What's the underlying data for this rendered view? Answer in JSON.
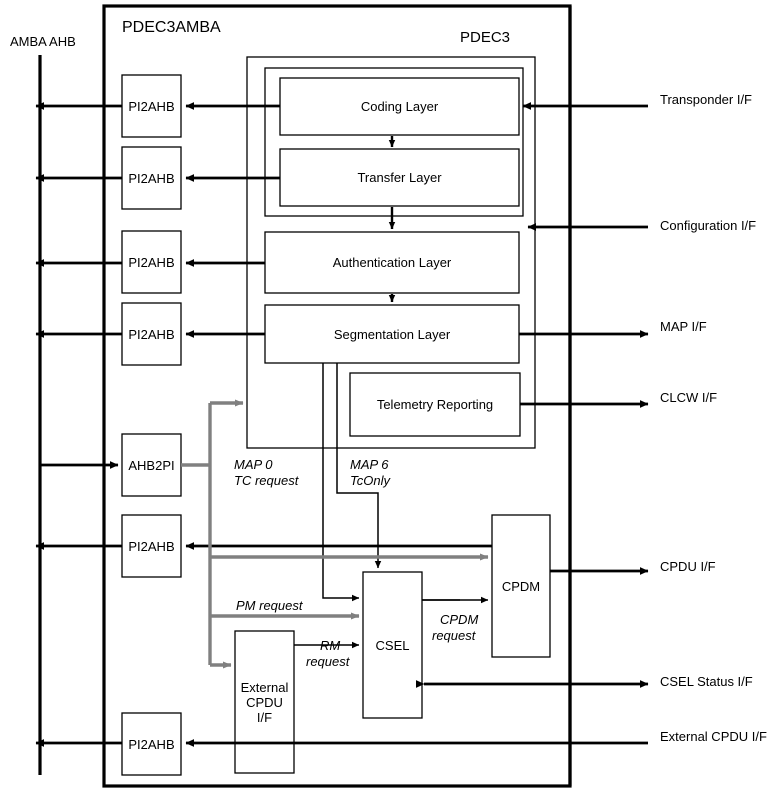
{
  "diagram": {
    "title_outer": "PDEC3AMBA",
    "title_inner": "PDEC3",
    "bus_label": "AMBA AHB",
    "colors": {
      "line": "#000000",
      "gray_line": "#808080",
      "background": "#ffffff",
      "box_stroke": "#000000"
    }
  },
  "bridges": {
    "pi2ahb_label": "PI2AHB",
    "ahb2pi_label": "AHB2PI",
    "instances": [
      {
        "id": "pi2ahb-1",
        "label": "PI2AHB"
      },
      {
        "id": "pi2ahb-2",
        "label": "PI2AHB"
      },
      {
        "id": "pi2ahb-3",
        "label": "PI2AHB"
      },
      {
        "id": "pi2ahb-4",
        "label": "PI2AHB"
      },
      {
        "id": "ahb2pi-1",
        "label": "AHB2PI"
      },
      {
        "id": "pi2ahb-5",
        "label": "PI2AHB"
      },
      {
        "id": "pi2ahb-6",
        "label": "PI2AHB"
      }
    ]
  },
  "layers": [
    {
      "id": "coding-layer",
      "label": "Coding Layer"
    },
    {
      "id": "transfer-layer",
      "label": "Transfer Layer"
    },
    {
      "id": "authentication-layer",
      "label": "Authentication Layer"
    },
    {
      "id": "segmentation-layer",
      "label": "Segmentation Layer"
    },
    {
      "id": "telemetry-reporting",
      "label": "Telemetry Reporting"
    }
  ],
  "blocks": [
    {
      "id": "cpdm",
      "label": "CPDM"
    },
    {
      "id": "csel",
      "label": "CSEL"
    },
    {
      "id": "external-cpdu-if",
      "label": "External\nCPDU\nI/F"
    }
  ],
  "interfaces": [
    {
      "id": "transponder-if",
      "label": "Transponder I/F",
      "direction": "in"
    },
    {
      "id": "configuration-if",
      "label": "Configuration I/F",
      "direction": "in"
    },
    {
      "id": "map-if",
      "label": "MAP I/F",
      "direction": "out"
    },
    {
      "id": "clcw-if",
      "label": "CLCW I/F",
      "direction": "out"
    },
    {
      "id": "cpdu-if",
      "label": "CPDU I/F",
      "direction": "out"
    },
    {
      "id": "csel-status-if",
      "label": "CSEL Status I/F",
      "direction": "bidirectional"
    },
    {
      "id": "external-cpdu-if-signal",
      "label": "External CPDU I/F",
      "direction": "in"
    }
  ],
  "signals": [
    {
      "id": "map0-tc-request",
      "line1": "MAP 0",
      "line2": "TC request"
    },
    {
      "id": "map6-tconly",
      "line1": "MAP 6",
      "line2": "TcOnly"
    },
    {
      "id": "pm-request",
      "line1": "PM request",
      "line2": ""
    },
    {
      "id": "rm-request",
      "line1": "RM",
      "line2": "request"
    },
    {
      "id": "cpdm-request",
      "line1": "CPDM",
      "line2": "request"
    }
  ]
}
